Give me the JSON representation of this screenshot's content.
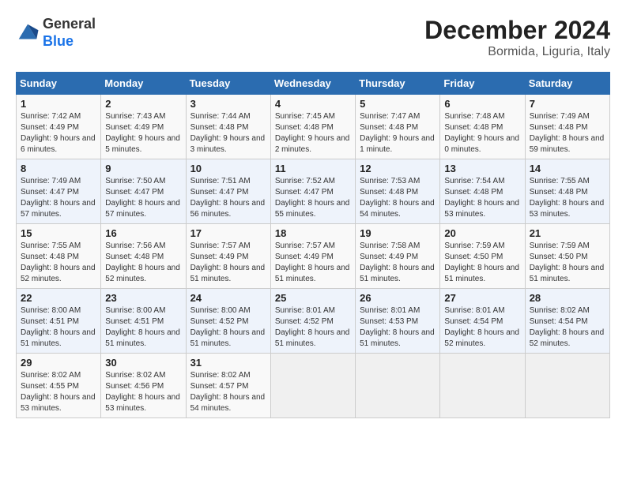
{
  "logo": {
    "general": "General",
    "blue": "Blue"
  },
  "title": "December 2024",
  "subtitle": "Bormida, Liguria, Italy",
  "days_header": [
    "Sunday",
    "Monday",
    "Tuesday",
    "Wednesday",
    "Thursday",
    "Friday",
    "Saturday"
  ],
  "weeks": [
    [
      {
        "day": "1",
        "sunrise": "7:42 AM",
        "sunset": "4:49 PM",
        "daylight": "9 hours and 6 minutes."
      },
      {
        "day": "2",
        "sunrise": "7:43 AM",
        "sunset": "4:49 PM",
        "daylight": "9 hours and 5 minutes."
      },
      {
        "day": "3",
        "sunrise": "7:44 AM",
        "sunset": "4:48 PM",
        "daylight": "9 hours and 3 minutes."
      },
      {
        "day": "4",
        "sunrise": "7:45 AM",
        "sunset": "4:48 PM",
        "daylight": "9 hours and 2 minutes."
      },
      {
        "day": "5",
        "sunrise": "7:47 AM",
        "sunset": "4:48 PM",
        "daylight": "9 hours and 1 minute."
      },
      {
        "day": "6",
        "sunrise": "7:48 AM",
        "sunset": "4:48 PM",
        "daylight": "9 hours and 0 minutes."
      },
      {
        "day": "7",
        "sunrise": "7:49 AM",
        "sunset": "4:48 PM",
        "daylight": "8 hours and 59 minutes."
      }
    ],
    [
      {
        "day": "8",
        "sunrise": "7:49 AM",
        "sunset": "4:47 PM",
        "daylight": "8 hours and 57 minutes."
      },
      {
        "day": "9",
        "sunrise": "7:50 AM",
        "sunset": "4:47 PM",
        "daylight": "8 hours and 57 minutes."
      },
      {
        "day": "10",
        "sunrise": "7:51 AM",
        "sunset": "4:47 PM",
        "daylight": "8 hours and 56 minutes."
      },
      {
        "day": "11",
        "sunrise": "7:52 AM",
        "sunset": "4:47 PM",
        "daylight": "8 hours and 55 minutes."
      },
      {
        "day": "12",
        "sunrise": "7:53 AM",
        "sunset": "4:48 PM",
        "daylight": "8 hours and 54 minutes."
      },
      {
        "day": "13",
        "sunrise": "7:54 AM",
        "sunset": "4:48 PM",
        "daylight": "8 hours and 53 minutes."
      },
      {
        "day": "14",
        "sunrise": "7:55 AM",
        "sunset": "4:48 PM",
        "daylight": "8 hours and 53 minutes."
      }
    ],
    [
      {
        "day": "15",
        "sunrise": "7:55 AM",
        "sunset": "4:48 PM",
        "daylight": "8 hours and 52 minutes."
      },
      {
        "day": "16",
        "sunrise": "7:56 AM",
        "sunset": "4:48 PM",
        "daylight": "8 hours and 52 minutes."
      },
      {
        "day": "17",
        "sunrise": "7:57 AM",
        "sunset": "4:49 PM",
        "daylight": "8 hours and 51 minutes."
      },
      {
        "day": "18",
        "sunrise": "7:57 AM",
        "sunset": "4:49 PM",
        "daylight": "8 hours and 51 minutes."
      },
      {
        "day": "19",
        "sunrise": "7:58 AM",
        "sunset": "4:49 PM",
        "daylight": "8 hours and 51 minutes."
      },
      {
        "day": "20",
        "sunrise": "7:59 AM",
        "sunset": "4:50 PM",
        "daylight": "8 hours and 51 minutes."
      },
      {
        "day": "21",
        "sunrise": "7:59 AM",
        "sunset": "4:50 PM",
        "daylight": "8 hours and 51 minutes."
      }
    ],
    [
      {
        "day": "22",
        "sunrise": "8:00 AM",
        "sunset": "4:51 PM",
        "daylight": "8 hours and 51 minutes."
      },
      {
        "day": "23",
        "sunrise": "8:00 AM",
        "sunset": "4:51 PM",
        "daylight": "8 hours and 51 minutes."
      },
      {
        "day": "24",
        "sunrise": "8:00 AM",
        "sunset": "4:52 PM",
        "daylight": "8 hours and 51 minutes."
      },
      {
        "day": "25",
        "sunrise": "8:01 AM",
        "sunset": "4:52 PM",
        "daylight": "8 hours and 51 minutes."
      },
      {
        "day": "26",
        "sunrise": "8:01 AM",
        "sunset": "4:53 PM",
        "daylight": "8 hours and 51 minutes."
      },
      {
        "day": "27",
        "sunrise": "8:01 AM",
        "sunset": "4:54 PM",
        "daylight": "8 hours and 52 minutes."
      },
      {
        "day": "28",
        "sunrise": "8:02 AM",
        "sunset": "4:54 PM",
        "daylight": "8 hours and 52 minutes."
      }
    ],
    [
      {
        "day": "29",
        "sunrise": "8:02 AM",
        "sunset": "4:55 PM",
        "daylight": "8 hours and 53 minutes."
      },
      {
        "day": "30",
        "sunrise": "8:02 AM",
        "sunset": "4:56 PM",
        "daylight": "8 hours and 53 minutes."
      },
      {
        "day": "31",
        "sunrise": "8:02 AM",
        "sunset": "4:57 PM",
        "daylight": "8 hours and 54 minutes."
      },
      null,
      null,
      null,
      null
    ]
  ],
  "labels": {
    "sunrise": "Sunrise:",
    "sunset": "Sunset:",
    "daylight": "Daylight:"
  }
}
